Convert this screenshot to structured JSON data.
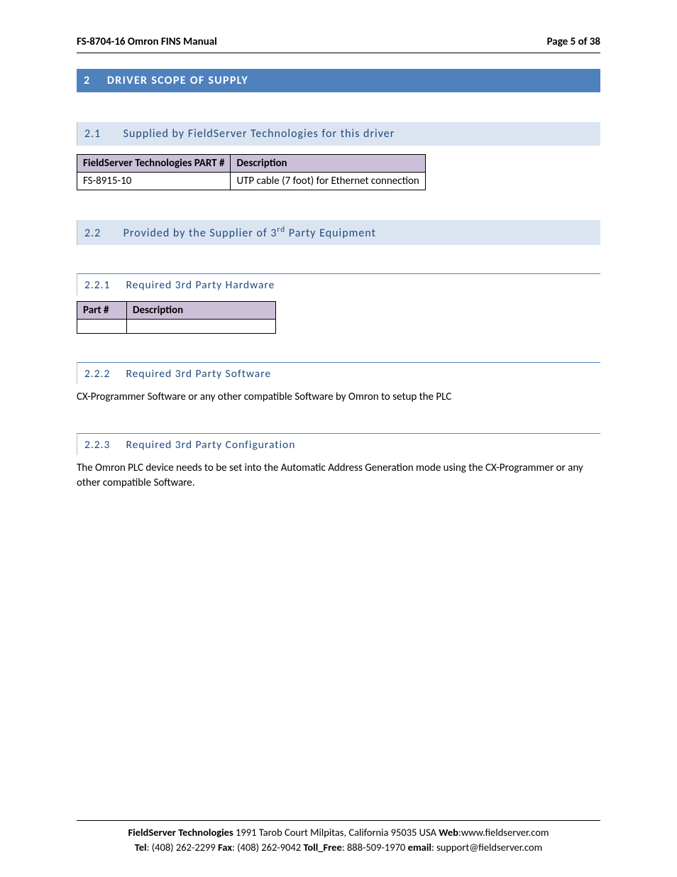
{
  "header": {
    "left": "FS-8704-16 Omron FINS Manual",
    "right": "Page 5 of 38"
  },
  "section": {
    "num": "2",
    "title": "DRIVER SCOPE OF SUPPLY"
  },
  "sub21": {
    "num": "2.1",
    "title": "Supplied by FieldServer Technologies for this driver",
    "table": {
      "h1": "FieldServer Technologies PART #",
      "h2": "Description",
      "r1c1": "FS-8915-10",
      "r1c2": "UTP cable (7 foot) for Ethernet connection"
    }
  },
  "sub22": {
    "num": "2.2",
    "title_pre": "Provided by the Supplier of 3",
    "title_sup": "rd",
    "title_post": " Party Equipment"
  },
  "sub221": {
    "num": "2.2.1",
    "title": "Required 3rd Party Hardware",
    "table": {
      "h1": "Part #",
      "h2": "Description"
    }
  },
  "sub222": {
    "num": "2.2.2",
    "title": "Required 3rd Party Software",
    "body": "CX-Programmer Software or any other compatible Software by Omron to setup the PLC"
  },
  "sub223": {
    "num": "2.2.3",
    "title": "Required 3rd Party Configuration",
    "body": "The Omron PLC device needs to be set into the Automatic Address Generation mode using the CX-Programmer or any other compatible Software."
  },
  "footer": {
    "company": "FieldServer Technologies",
    "addr": " 1991 Tarob Court Milpitas, California 95035 USA  ",
    "web_lbl": "Web",
    "web_val": ":www.fieldserver.com",
    "tel_lbl": "Tel",
    "tel_val": ": (408) 262-2299   ",
    "fax_lbl": "Fax",
    "fax_val": ": (408) 262-9042   ",
    "toll_lbl": "Toll_Free",
    "toll_val": ": 888-509-1970   ",
    "email_lbl": "email",
    "email_val": ": support@fieldserver.com"
  }
}
